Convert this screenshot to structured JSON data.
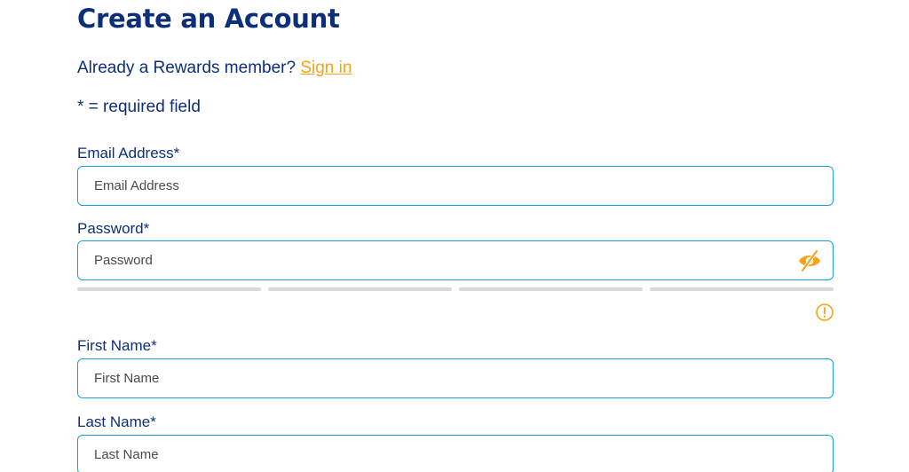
{
  "header": {
    "title": "Create an Account"
  },
  "signin": {
    "prompt": "Already a Rewards member?",
    "link_label": "Sign in"
  },
  "required_note": "* = required field",
  "fields": {
    "email": {
      "label": "Email Address*",
      "placeholder": "Email Address"
    },
    "password": {
      "label": "Password*",
      "placeholder": "Password",
      "toggle_icon": "eye-slash-icon"
    },
    "first_name": {
      "label": "First Name*",
      "placeholder": "First Name"
    },
    "last_name": {
      "label": "Last Name*",
      "placeholder": "Last Name"
    }
  },
  "password_strength": {
    "segments": 4,
    "filled": 0,
    "info_icon": "info-circle-icon"
  },
  "colors": {
    "text_primary": "#0d2f7a",
    "accent": "#f5a318",
    "field_border": "#1aa0dd",
    "strength_bar": "#d7d9dd"
  }
}
